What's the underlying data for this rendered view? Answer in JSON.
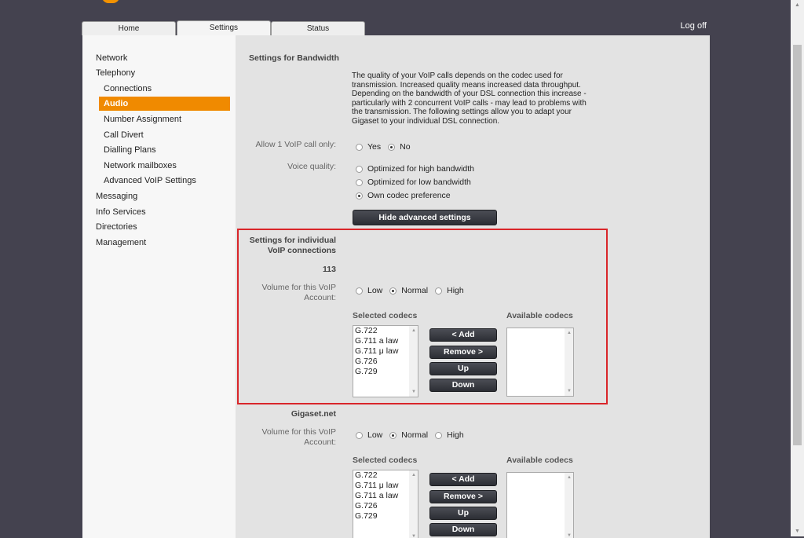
{
  "tabs": [
    {
      "label": "Home"
    },
    {
      "label": "Settings"
    },
    {
      "label": "Status"
    }
  ],
  "logoff": "Log off",
  "help": "?",
  "nav": {
    "items": [
      {
        "label": "Network"
      },
      {
        "label": "Telephony"
      },
      {
        "label": "Connections"
      },
      {
        "label": "Audio"
      },
      {
        "label": "Number Assignment"
      },
      {
        "label": "Call Divert"
      },
      {
        "label": "Dialling Plans"
      },
      {
        "label": "Network mailboxes"
      },
      {
        "label": "Advanced VoIP Settings"
      },
      {
        "label": "Messaging"
      },
      {
        "label": "Info Services"
      },
      {
        "label": "Directories"
      },
      {
        "label": "Management"
      }
    ]
  },
  "bandwidth": {
    "title": "Settings for Bandwidth",
    "description": "The quality of your VoIP calls depends on the codec used for transmission. Increased quality means increased data throughput. Depending on the bandwidth of your DSL connection this increase - particularly with 2 concurrent VoIP calls - may lead to problems with the transmission. The following settings allow you to adapt your Gigaset to your individual DSL connection.",
    "allow_label": "Allow 1 VoIP call only:",
    "allow_yes": "Yes",
    "allow_no": "No",
    "voice_label": "Voice quality:",
    "voice_opt1": "Optimized for high bandwidth",
    "voice_opt2": "Optimized for low bandwidth",
    "voice_opt3": "Own codec preference",
    "hide_button": "Hide advanced settings"
  },
  "individual": {
    "title_line1": "Settings for individual",
    "title_line2": "VoIP connections"
  },
  "accounts": [
    {
      "name": "113",
      "volume_label_line1": "Volume for this VoIP",
      "volume_label_line2": "Account:",
      "vol_low": "Low",
      "vol_normal": "Normal",
      "vol_high": "High",
      "selected_title": "Selected codecs",
      "available_title": "Available codecs",
      "selected_codecs": [
        "G.722",
        "G.711 a law",
        "G.711 μ law",
        "G.726",
        "G.729"
      ],
      "btn_add": "< Add",
      "btn_remove": "Remove >",
      "btn_up": "Up",
      "btn_down": "Down"
    },
    {
      "name": "Gigaset.net",
      "volume_label_line1": "Volume for this VoIP",
      "volume_label_line2": "Account:",
      "vol_low": "Low",
      "vol_normal": "Normal",
      "vol_high": "High",
      "selected_title": "Selected codecs",
      "available_title": "Available codecs",
      "selected_codecs": [
        "G.722",
        "G.711 μ law",
        "G.711 a law",
        "G.726",
        "G.729"
      ],
      "btn_add": "< Add",
      "btn_remove": "Remove >",
      "btn_up": "Up",
      "btn_down": "Down"
    }
  ],
  "colors": {
    "accent": "#f08a00",
    "highlight": "#d9262a",
    "background": "#44424f"
  }
}
